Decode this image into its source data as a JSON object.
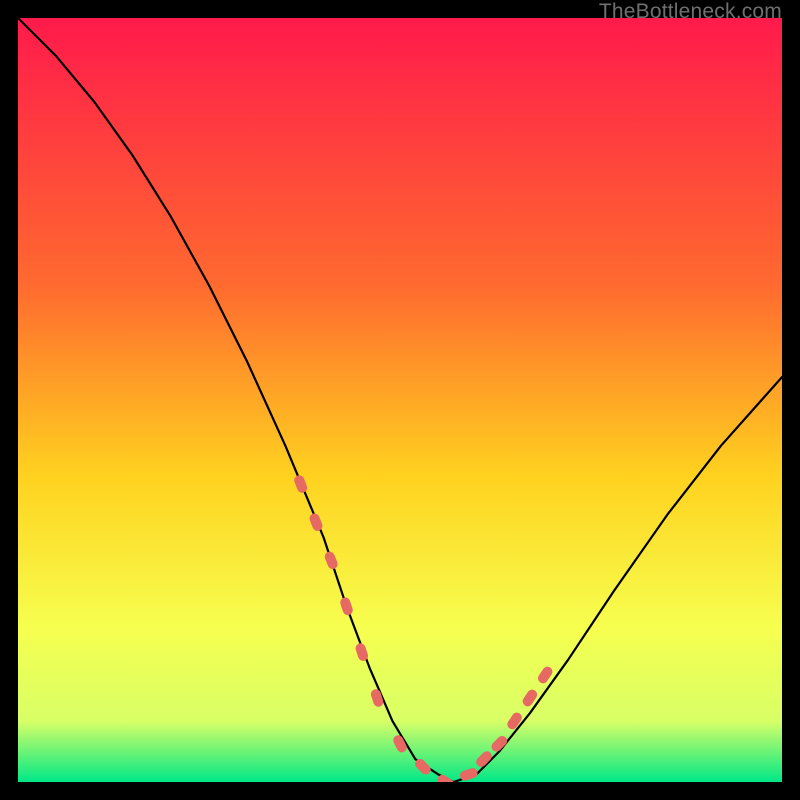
{
  "watermark": "TheBottleneck.com",
  "colors": {
    "black": "#000000",
    "curve": "#000000",
    "dot": "#e66a63",
    "gradient_top": "#ff1a4b",
    "gradient_mid1": "#ff6a2f",
    "gradient_mid2": "#ffd21f",
    "gradient_mid3": "#f6ff4f",
    "gradient_mid4": "#d8ff66",
    "gradient_bottom": "#00e887"
  },
  "chart_data": {
    "type": "line",
    "title": "",
    "xlabel": "",
    "ylabel": "",
    "xlim": [
      0,
      100
    ],
    "ylim": [
      0,
      100
    ],
    "grid": false,
    "series": [
      {
        "name": "bottleneck-curve",
        "x": [
          0,
          5,
          10,
          15,
          20,
          25,
          30,
          35,
          40,
          43,
          46,
          49,
          52,
          55,
          57,
          60,
          63,
          67,
          72,
          78,
          85,
          92,
          100
        ],
        "values": [
          100,
          95,
          89,
          82,
          74,
          65,
          55,
          44,
          32,
          23,
          15,
          8,
          3,
          1,
          0,
          1,
          4,
          9,
          16,
          25,
          35,
          44,
          53
        ]
      }
    ],
    "marker_points": {
      "name": "highlight-dots",
      "x": [
        37,
        39,
        41,
        43,
        45,
        47,
        50,
        53,
        56,
        59,
        61,
        63,
        65,
        67,
        69
      ],
      "values": [
        39,
        34,
        29,
        23,
        17,
        11,
        5,
        2,
        0,
        1,
        3,
        5,
        8,
        11,
        14
      ]
    }
  }
}
